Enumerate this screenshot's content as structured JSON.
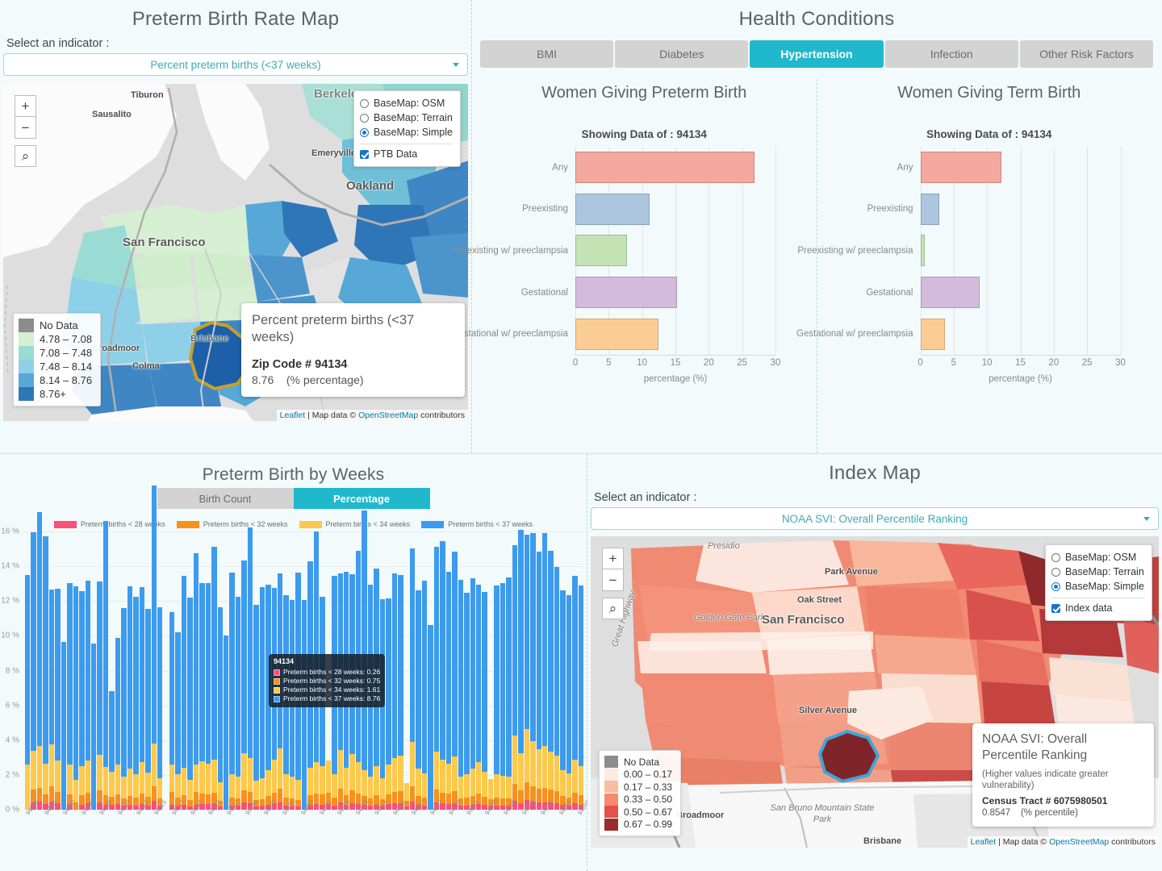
{
  "preterm_map": {
    "title": "Preterm Birth Rate Map",
    "indicator_label": "Select an indicator :",
    "indicator_value": "Percent preterm births (<37 weeks)",
    "zoom_in": "+",
    "zoom_out": "−",
    "search_icon": "⌕",
    "layers": {
      "osm": "BaseMap: OSM",
      "terrain": "BaseMap: Terrain",
      "simple": "BaseMap: Simple",
      "data": "PTB Data"
    },
    "legend": [
      {
        "label": "No Data",
        "color": "#8c8c8c"
      },
      {
        "label": "4.78 – 7.08",
        "color": "#d6efd2"
      },
      {
        "label": "7.08 – 7.48",
        "color": "#9adcd4"
      },
      {
        "label": "7.48 – 8.14",
        "color": "#8ed0e8"
      },
      {
        "label": "8.14 – 8.76",
        "color": "#57a8d6"
      },
      {
        "label": "8.76+",
        "color": "#2f76b8"
      }
    ],
    "popup": {
      "title": "Percent preterm births (<37 weeks)",
      "zip": "Zip Code # 94134",
      "value": "8.76",
      "unit": "(% percentage)"
    },
    "attribution": {
      "leaflet": "Leaflet",
      "mid": " | Map data © ",
      "osm": "OpenStreetMap",
      "tail": " contributors"
    },
    "map_labels": [
      "Tiburon",
      "Sausalito",
      "Berkeley",
      "Emeryville",
      "Oakland",
      "San Francisco",
      "Broadmoor",
      "Colma",
      "Brisbane"
    ]
  },
  "health": {
    "title": "Health Conditions",
    "tabs": [
      {
        "label": "BMI",
        "active": false
      },
      {
        "label": "Diabetes",
        "active": false
      },
      {
        "label": "Hypertension",
        "active": true
      },
      {
        "label": "Infection",
        "active": false
      },
      {
        "label": "Other Risk Factors",
        "active": false
      }
    ],
    "left_chart_title": "Women Giving Preterm Birth",
    "right_chart_title": "Women Giving Term Birth",
    "left_subtitle": "Showing Data of : 94134",
    "right_subtitle": "Showing Data of : 94134"
  },
  "weeks": {
    "title": "Preterm Birth by Weeks",
    "toggle": [
      {
        "label": "Birth Count",
        "active": false
      },
      {
        "label": "Percentage",
        "active": true
      }
    ],
    "tooltip": {
      "zip": "94134",
      "rows": [
        {
          "label": "Preterm births < 28 weeks: 0.26",
          "color": "#f94f78"
        },
        {
          "label": "Preterm births < 32 weeks: 0.75",
          "color": "#f8901e"
        },
        {
          "label": "Preterm births < 34 weeks: 1.61",
          "color": "#fcc94d"
        },
        {
          "label": "Preterm births < 37 weeks: 8.76",
          "color": "#3d9bed"
        }
      ]
    }
  },
  "index_map": {
    "title": "Index Map",
    "indicator_label": "Select an indicator :",
    "indicator_value": "NOAA SVI: Overall Percentile Ranking",
    "zoom_in": "+",
    "zoom_out": "−",
    "search_icon": "⌕",
    "layers": {
      "osm": "BaseMap: OSM",
      "terrain": "BaseMap: Terrain",
      "simple": "BaseMap: Simple",
      "data": "Index data"
    },
    "legend": [
      {
        "label": "No Data",
        "color": "#8c8c8c"
      },
      {
        "label": "0.00 – 0.17",
        "color": "#fdeae0"
      },
      {
        "label": "0.17 – 0.33",
        "color": "#fbbca4"
      },
      {
        "label": "0.33 – 0.50",
        "color": "#f58b6d"
      },
      {
        "label": "0.50 – 0.67",
        "color": "#e2514a"
      },
      {
        "label": "0.67 – 0.99",
        "color": "#9b2d2e"
      }
    ],
    "popup": {
      "title": "NOAA SVI: Overall Percentile Ranking",
      "note": "(Higher values indicate greater vulnerability)",
      "tract": "Census Tract # 6075980501",
      "value": "0.8547",
      "unit": "(% percentile)"
    },
    "attribution": {
      "leaflet": "Leaflet",
      "mid": " | Map data © ",
      "osm": "OpenStreetMap",
      "tail": " contributors"
    },
    "map_labels": [
      "Presidio",
      "Park Avenue",
      "Oak Street",
      "Golden Gate Park",
      "San Francisco",
      "Great Highway",
      "Silver Avenue",
      "Broadmoor",
      "San Bruno Mountain State Park",
      "Brisbane"
    ]
  },
  "chart_data": [
    {
      "type": "bar",
      "orientation": "horizontal",
      "title": "Women Giving Preterm Birth",
      "subtitle": "Showing Data of : 94134",
      "categories": [
        "Any",
        "Preexisting",
        "Preexisting w/ preeclampsia",
        "Gestational",
        "Gestational w/ preeclampsia"
      ],
      "values": [
        26.9,
        11.1,
        7.8,
        15.3,
        12.5
      ],
      "colors": [
        "#f4a8a0",
        "#adc6e0",
        "#c4e3b5",
        "#d4bbdd",
        "#fbcd94"
      ],
      "xlabel": "percentage (%)",
      "ylabel": "",
      "xlim": [
        0,
        30
      ],
      "xticks": [
        0,
        5,
        10,
        15,
        20,
        25,
        30
      ],
      "grid": true,
      "legend": "none"
    },
    {
      "type": "bar",
      "orientation": "horizontal",
      "title": "Women Giving Term Birth",
      "subtitle": "Showing Data of : 94134",
      "categories": [
        "Any",
        "Preexisting",
        "Preexisting w/ preeclampsia",
        "Gestational",
        "Gestational w/ preeclampsia"
      ],
      "values": [
        12.2,
        2.9,
        0.7,
        8.9,
        3.7
      ],
      "colors": [
        "#f4a8a0",
        "#adc6e0",
        "#c4e3b5",
        "#d4bbdd",
        "#fbcd94"
      ],
      "xlabel": "percentage (%)",
      "ylabel": "",
      "xlim": [
        0,
        30
      ],
      "xticks": [
        0,
        5,
        10,
        15,
        20,
        25,
        30
      ],
      "grid": true,
      "legend": "none"
    },
    {
      "type": "bar",
      "stacked": true,
      "title": "Preterm Birth by Weeks",
      "xlabel": "",
      "ylabel": "",
      "ylim": [
        0,
        16
      ],
      "yticks": [
        "0 %",
        "2 %",
        "4 %",
        "6 %",
        "8 %",
        "10 %",
        "12 %",
        "14 %",
        "16 %"
      ],
      "grid": true,
      "legend_position": "top",
      "categories": [
        "94005",
        "94014",
        "94015",
        "94066",
        "94080",
        "94103",
        "94105",
        "94107",
        "94108",
        "94109",
        "94110",
        "94111",
        "94112",
        "94114",
        "94115",
        "94116",
        "94117",
        "94118",
        "94121",
        "94122",
        "94123",
        "94124",
        "94127",
        "94129",
        "94130",
        "94131",
        "94132",
        "94133",
        "94134",
        "94401",
        "94403",
        "94501",
        "94502",
        "94505",
        "94506",
        "94507",
        "94509",
        "94513",
        "94514",
        "94517",
        "94518",
        "94519",
        "94520",
        "94521",
        "94523",
        "94526",
        "94528",
        "94530",
        "94531",
        "94536",
        "94538",
        "94539",
        "94541",
        "94542",
        "94544",
        "94545",
        "94546",
        "94550",
        "94551",
        "94552",
        "94555",
        "94560",
        "94561",
        "94563",
        "94565",
        "94566",
        "94568",
        "94569",
        "94577",
        "94578",
        "94579",
        "94580",
        "94582",
        "94583",
        "94586",
        "94587",
        "94588",
        "94595",
        "94596",
        "94597",
        "94598",
        "94601",
        "94602",
        "94603",
        "94605",
        "94606",
        "94607",
        "94608",
        "94609",
        "94610",
        "94611",
        "94612",
        "94613"
      ],
      "series": [
        {
          "name": "Preterm births < 28 weeks",
          "color": "#f94f78",
          "values": [
            0.0,
            0.42,
            0.45,
            0.33,
            0.47,
            0.38,
            0.0,
            0.31,
            0.0,
            0.3,
            0.36,
            0.0,
            0.41,
            0.29,
            0.26,
            0.31,
            0.22,
            0.28,
            0.24,
            0.33,
            0.25,
            0.5,
            0.22,
            0.0,
            0.26,
            0.24,
            0.29,
            0.2,
            0.26,
            0.33,
            0.31,
            0.35,
            0.18,
            0.0,
            0.24,
            0.22,
            0.41,
            0.36,
            0.19,
            0.21,
            0.27,
            0.35,
            0.44,
            0.24,
            0.22,
            0.2,
            0.0,
            0.29,
            0.33,
            0.3,
            0.34,
            0.24,
            0.42,
            0.29,
            0.39,
            0.33,
            0.27,
            0.22,
            0.3,
            0.21,
            0.31,
            0.36,
            0.38,
            0.18,
            0.47,
            0.28,
            0.25,
            0.0,
            0.41,
            0.35,
            0.32,
            0.37,
            0.22,
            0.24,
            0.28,
            0.33,
            0.26,
            0.21,
            0.24,
            0.23,
            0.22,
            0.52,
            0.39,
            0.56,
            0.48,
            0.42,
            0.44,
            0.41,
            0.38,
            0.27,
            0.25,
            0.35,
            0.3
          ]
        },
        {
          "name": "Preterm births < 32 weeks",
          "color": "#f8901e",
          "values": [
            0.0,
            0.72,
            0.78,
            0.55,
            0.86,
            0.62,
            0.0,
            0.58,
            0.42,
            0.55,
            0.63,
            0.0,
            0.71,
            0.55,
            0.49,
            0.57,
            0.42,
            0.52,
            0.45,
            0.6,
            0.47,
            0.86,
            0.41,
            0.0,
            0.75,
            0.45,
            0.54,
            0.38,
            0.75,
            0.62,
            0.58,
            0.64,
            0.35,
            0.0,
            0.45,
            0.41,
            0.72,
            0.66,
            0.36,
            0.4,
            0.5,
            0.64,
            0.78,
            0.45,
            0.41,
            0.38,
            0.0,
            0.54,
            0.61,
            0.56,
            0.62,
            0.45,
            0.77,
            0.54,
            0.71,
            0.61,
            0.5,
            0.41,
            0.55,
            0.39,
            0.57,
            0.66,
            0.7,
            0.34,
            0.86,
            0.52,
            0.46,
            0.0,
            0.75,
            0.64,
            0.59,
            0.68,
            0.41,
            0.45,
            0.52,
            0.61,
            0.48,
            0.39,
            0.45,
            0.43,
            0.41,
            0.95,
            0.72,
            1.02,
            0.88,
            0.77,
            0.81,
            0.75,
            0.7,
            0.5,
            0.46,
            0.64,
            0.55
          ]
        },
        {
          "name": "Preterm births < 34 weeks",
          "color": "#fcc94d",
          "values": [
            2.6,
            2.25,
            2.45,
            1.75,
            2.45,
            1.85,
            0.0,
            1.7,
            1.3,
            1.65,
            1.85,
            0.0,
            2.05,
            1.6,
            1.45,
            1.7,
            1.25,
            1.55,
            1.35,
            1.8,
            1.4,
            2.45,
            1.2,
            0.0,
            1.61,
            1.35,
            1.6,
            1.15,
            1.61,
            1.85,
            1.75,
            1.9,
            1.05,
            0.0,
            1.35,
            1.25,
            2.1,
            1.95,
            1.1,
            1.2,
            1.5,
            1.9,
            2.3,
            1.35,
            1.25,
            1.15,
            0.0,
            1.6,
            1.8,
            1.65,
            1.85,
            1.35,
            2.25,
            1.6,
            2.1,
            1.8,
            1.5,
            1.25,
            1.65,
            1.2,
            1.7,
            1.95,
            2.05,
            1.0,
            2.55,
            1.55,
            1.4,
            0.0,
            2.2,
            1.9,
            1.75,
            2.0,
            1.25,
            1.35,
            1.55,
            1.8,
            1.45,
            1.15,
            1.35,
            1.3,
            1.25,
            2.8,
            2.15,
            3.05,
            2.6,
            2.3,
            2.4,
            2.2,
            2.05,
            1.5,
            1.4,
            1.9,
            1.65
          ]
        },
        {
          "name": "Preterm births < 37 weeks",
          "color": "#3d9bed",
          "values": [
            10.9,
            12.55,
            13.45,
            13.1,
            8.9,
            9.85,
            9.65,
            10.45,
            11.15,
            10.05,
            10.35,
            9.55,
            9.95,
            14.15,
            4.6,
            7.3,
            9.7,
            10.5,
            10.2,
            10.05,
            9.45,
            14.85,
            9.8,
            0.0,
            8.76,
            8.15,
            11.0,
            10.45,
            12.15,
            10.25,
            10.4,
            12.25,
            10.05,
            10.0,
            11.6,
            10.35,
            11.1,
            13.25,
            10.15,
            11.0,
            10.65,
            9.85,
            10.05,
            10.3,
            10.2,
            11.9,
            12.05,
            11.85,
            13.25,
            9.75,
            0.0,
            11.4,
            10.15,
            11.25,
            10.35,
            12.15,
            14.95,
            11.05,
            11.35,
            10.3,
            9.55,
            10.6,
            10.35,
            0.0,
            11.15,
            10.25,
            11.05,
            10.6,
            11.75,
            12.55,
            11.0,
            11.8,
            11.35,
            10.45,
            10.95,
            10.2,
            10.35,
            0.0,
            10.85,
            11.05,
            11.5,
            10.95,
            12.85,
            11.2,
            11.95,
            11.35,
            12.25,
            11.55,
            10.85,
            10.35,
            10.25,
            10.55,
            10.4
          ]
        }
      ]
    }
  ]
}
